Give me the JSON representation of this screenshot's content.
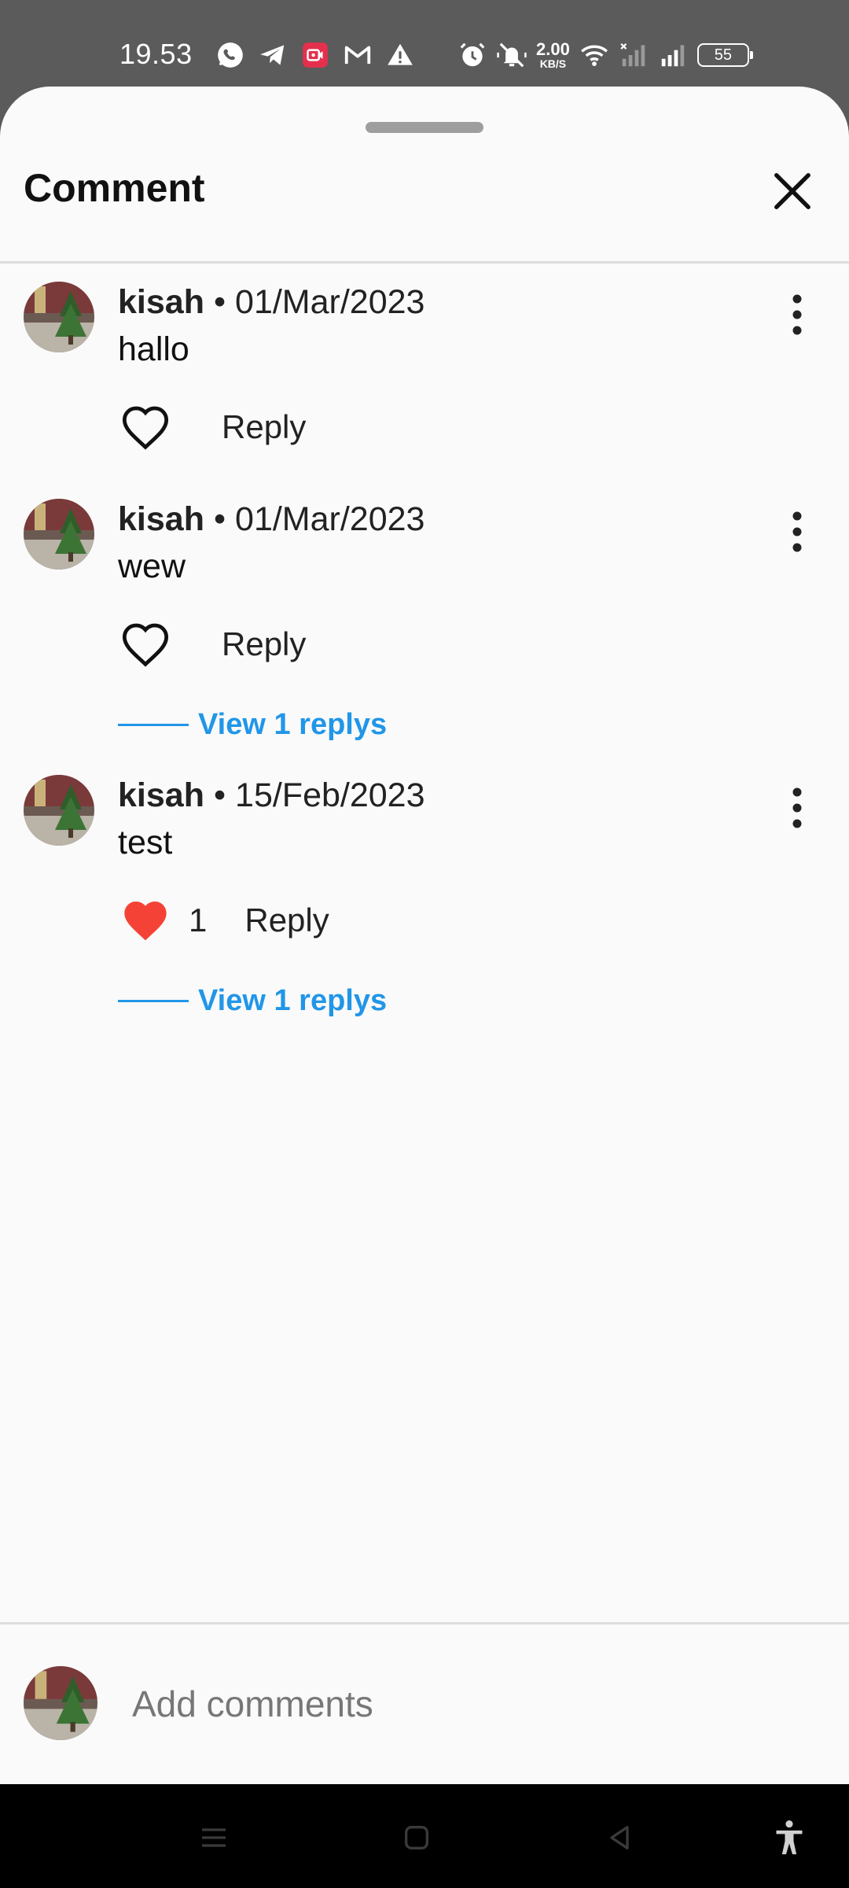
{
  "status_bar": {
    "time": "19.53",
    "net_speed_value": "2.00",
    "net_speed_unit": "KB/S",
    "battery": "55"
  },
  "sheet": {
    "title": "Comment"
  },
  "comments": [
    {
      "user": "kisah",
      "separator": "•",
      "date": "01/Mar/2023",
      "text": "hallo",
      "liked": false,
      "reply_label": "Reply",
      "view_replies": null
    },
    {
      "user": "kisah",
      "separator": "•",
      "date": "01/Mar/2023",
      "text": "wew",
      "liked": false,
      "reply_label": "Reply",
      "view_replies": "View 1 replys"
    },
    {
      "user": "kisah",
      "separator": "•",
      "date": "15/Feb/2023",
      "text": "test",
      "liked": true,
      "like_count": "1",
      "reply_label": "Reply",
      "view_replies": "View 1 replys"
    }
  ],
  "composer": {
    "placeholder": "Add comments"
  },
  "colors": {
    "accent": "#2196e8",
    "like_active": "#f44336",
    "sheet_background": "#fafafa"
  },
  "icons": {
    "close": "close-icon",
    "more": "more-vert-icon",
    "like": "heart-icon",
    "nav": [
      "menu-icon",
      "home-icon",
      "back-icon",
      "accessibility-icon"
    ]
  }
}
